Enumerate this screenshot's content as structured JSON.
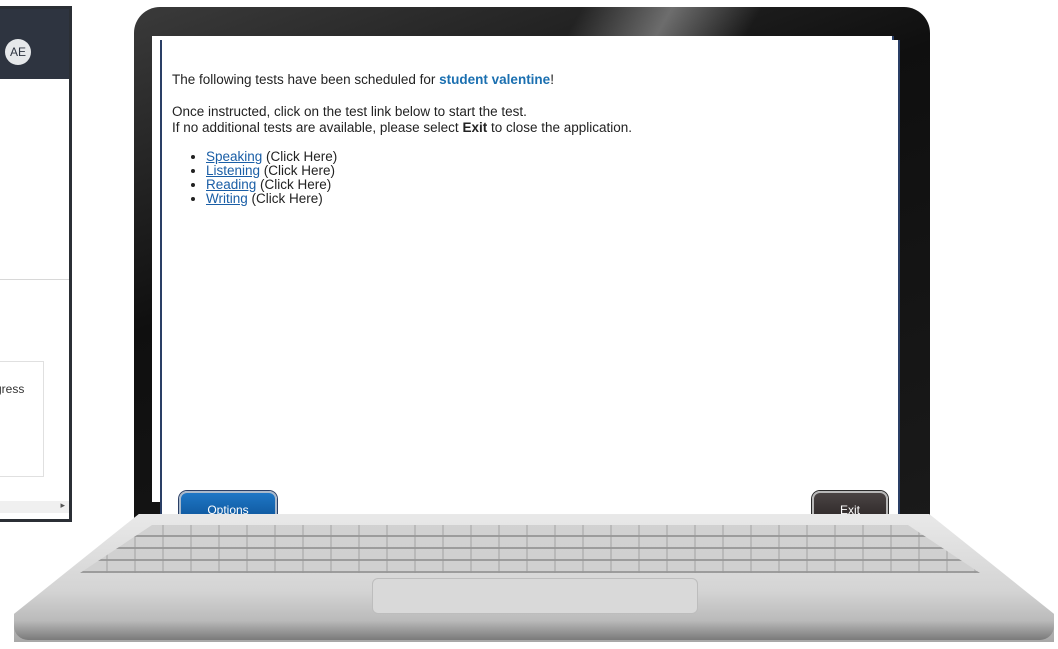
{
  "background_app": {
    "avatar_initials": "AE",
    "card_text": "gress"
  },
  "test_screen": {
    "intro_prefix": "The following tests have been scheduled for ",
    "student_name": "student valentine",
    "intro_suffix": "!",
    "instruction_line": "Once instructed, click on the test link below to start the test.",
    "exit_line_prefix": "If no additional tests are available, please select ",
    "exit_word": "Exit",
    "exit_line_suffix": " to close the application.",
    "tests": [
      {
        "name": "Speaking",
        "hint": " (Click Here)"
      },
      {
        "name": "Listening",
        "hint": " (Click Here)"
      },
      {
        "name": "Reading",
        "hint": " (Click Here)"
      },
      {
        "name": "Writing",
        "hint": " (Click Here)"
      }
    ],
    "options_label": "Options",
    "exit_label": "Exit"
  },
  "colors": {
    "student_name": "#1a6fb0",
    "link": "#1a5ea6",
    "options_button": "#0a4c8f",
    "exit_button": "#251f1f"
  }
}
